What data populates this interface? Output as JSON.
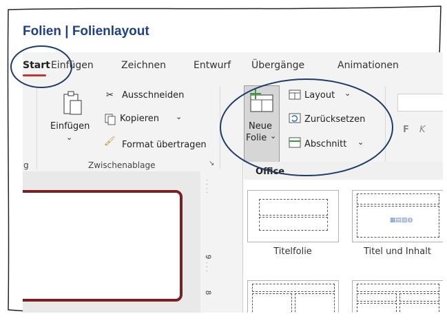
{
  "page_title": "Folien | Folienlayout",
  "tabs": [
    "Start",
    "Einfügen",
    "Zeichnen",
    "Entwurf",
    "Übergänge",
    "Animationen"
  ],
  "clipboard": {
    "paste_label": "Einfügen",
    "cut_label": "Ausschneiden",
    "copy_label": "Kopieren",
    "format_painter_label": "Format übertragen",
    "group_label": "Zwischenablage",
    "prev_group_partial": "gig"
  },
  "slides": {
    "new_slide_line1": "Neue",
    "new_slide_line2": "Folie",
    "layout_label": "Layout",
    "reset_label": "Zurücksetzen",
    "section_label": "Abschnitt"
  },
  "font_group": {
    "bold": "F",
    "italic": "K"
  },
  "layout_gallery": {
    "section_title": "Office",
    "items": [
      "Titelfolie",
      "Titel und Inhalt"
    ]
  },
  "ruler": {
    "label_9": "9",
    "label_8": "8"
  },
  "colors": {
    "accent_red": "#c0392b",
    "title_blue": "#1f3f86",
    "annotation_navy": "#1d3a6b",
    "slide_border": "#7a1f24"
  }
}
